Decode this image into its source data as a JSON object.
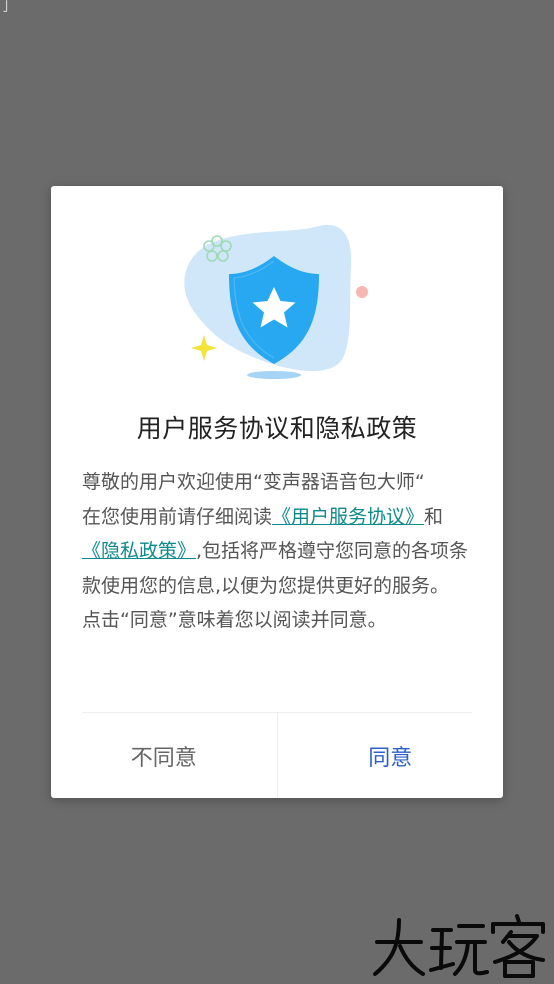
{
  "edge_glyph": "亅",
  "dialog": {
    "title": "用户服务协议和隐私政策",
    "body": {
      "line1": "尊敬的用户欢迎使用“变声器语音包大师“",
      "line2_prefix": "在您使用前请仔细阅读",
      "user_agreement_link": "《用户服务协议》",
      "line2_and": "和",
      "privacy_link": "《隐私政策》",
      "line3_suffix": ",包括将严格遵守您同意的各项条款使用您的信息,以便为您提供更好的服务。",
      "line4": "点击“同意”意味着您以阅读并同意。"
    },
    "buttons": {
      "decline": "不同意",
      "agree": "同意"
    }
  },
  "watermark": {
    "text": "大玩客",
    "icon": "watermark-logo"
  },
  "illustration": {
    "icon": "security-shield-icon",
    "colors": {
      "blob": "#cfe7f9",
      "shield": "#28a8f0",
      "sparkle": "#f2e23a",
      "dot": "#f6b6b2",
      "flower": "#9fd9b5"
    }
  },
  "colors": {
    "link": "#0e8a8a",
    "agree": "#2c62c7",
    "decline": "#666666",
    "backdrop": "#6b6b6b"
  }
}
